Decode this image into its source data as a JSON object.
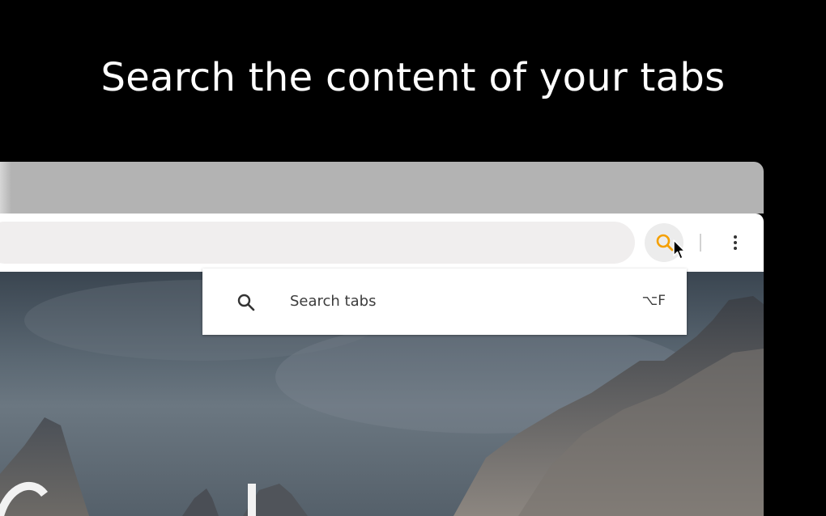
{
  "headline": "Search the content of your tabs",
  "toolbar": {
    "extension_icon": "search-icon",
    "extension_icon_color": "#f5a000",
    "menu_icon": "three-dot-menu-icon"
  },
  "dropdown": {
    "icon": "search-icon",
    "item_label": "Search tabs",
    "shortcut": "⌥F"
  },
  "colors": {
    "background": "#000000",
    "accent": "#f5a000"
  }
}
